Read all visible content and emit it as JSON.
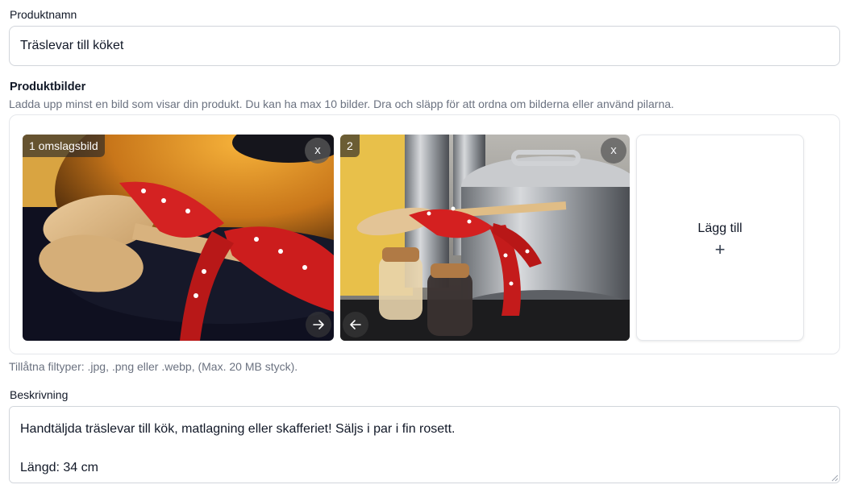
{
  "product_name": {
    "label": "Produktnamn",
    "value": "Träslevar till köket"
  },
  "product_images": {
    "label": "Produktbilder",
    "help": "Ladda upp minst en bild som visar din produkt. Du kan ha max 10 bilder. Dra och släpp för att ordna om bilderna eller använd pilarna.",
    "images": [
      {
        "badge": "1 omslagsbild",
        "remove": "x",
        "icon": "arrow-right-icon"
      },
      {
        "badge": "2",
        "remove": "x",
        "icon": "arrow-left-icon"
      }
    ],
    "add_label": "Lägg till",
    "add_icon": "+",
    "file_types": "Tillåtna filtyper: .jpg, .png eller .webp, (Max. 20 MB styck)."
  },
  "description": {
    "label": "Beskrivning",
    "value": "Handtäljda träslevar till kök, matlagning eller skafferiet! Säljs i par i fin rosett.\n\nLängd: 34 cm"
  }
}
